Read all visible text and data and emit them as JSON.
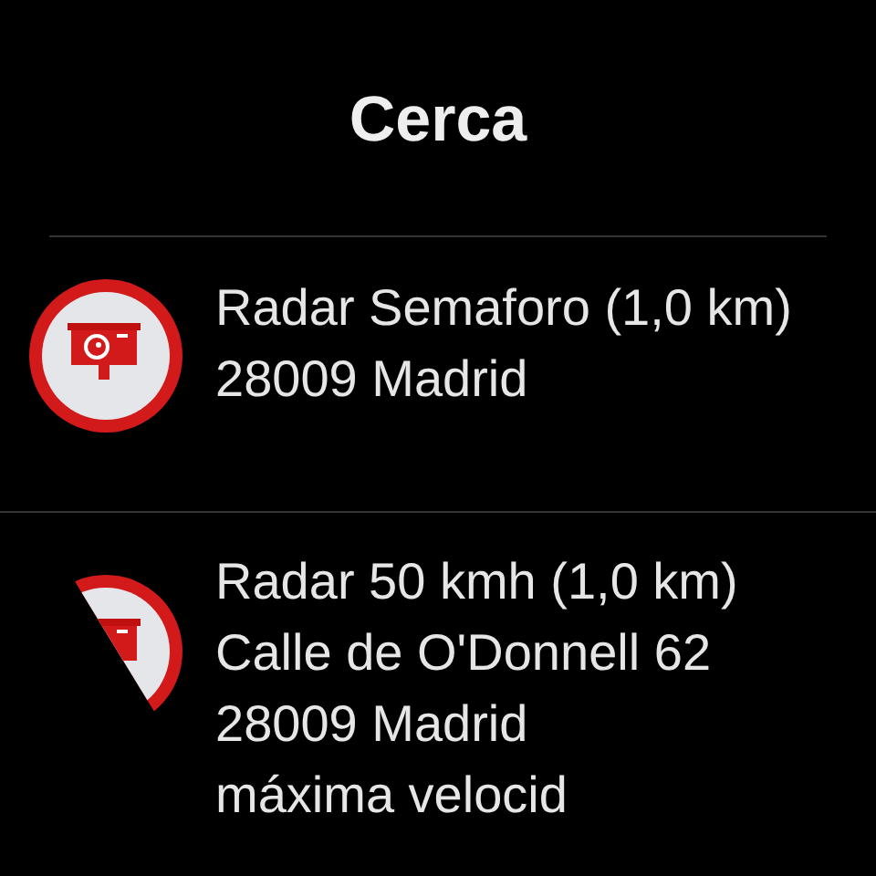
{
  "title": "Cerca",
  "items": [
    {
      "lines": [
        "Radar Semaforo (1,0 km)",
        "28009 Madrid"
      ],
      "icon_revealed": true
    },
    {
      "lines": [
        "Radar 50 kmh (1,0 km)",
        "Calle de O'Donnell 62",
        "28009 Madrid",
        "máxima velocid"
      ],
      "icon_revealed": false
    }
  ]
}
